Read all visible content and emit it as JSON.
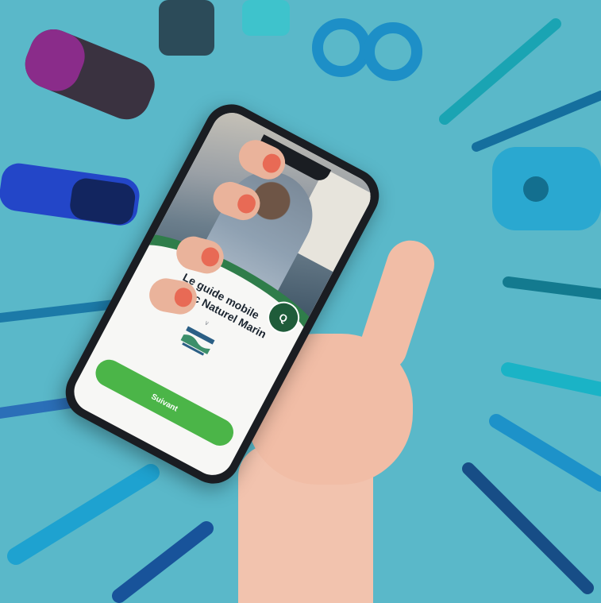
{
  "image": {
    "description_items": [
      "scattered blue stationery",
      "hand holding smartphone"
    ]
  },
  "phone_screen": {
    "title_line1": "Le guide mobile",
    "title_line2": "du Parc Naturel Marin",
    "subtitle": "",
    "chevron": "∨",
    "button_label": "Suivant",
    "footer_text": "",
    "logo_initial": "Q"
  },
  "colors": {
    "background": "#5ab8c9",
    "button": "#4bb548",
    "brand_green": "#2f7d4a"
  }
}
